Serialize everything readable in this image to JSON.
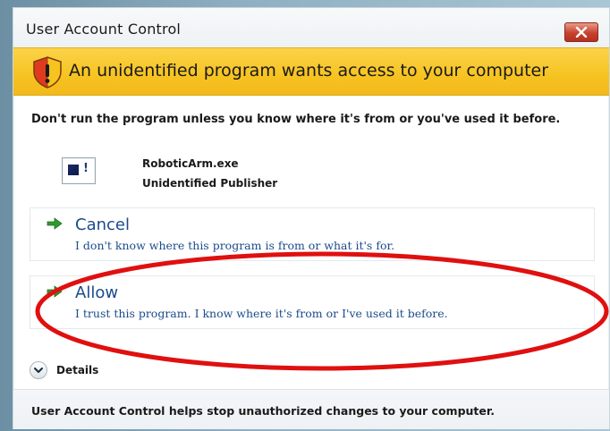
{
  "window": {
    "title": "User Account Control",
    "close_icon": "close-icon"
  },
  "banner": {
    "icon": "shield-warning-icon",
    "text": "An unidentified program wants access to your computer"
  },
  "warning_text": "Don't run the program unless you know where it's from or you've used it before.",
  "program": {
    "icon": "program-icon",
    "name": "RoboticArm.exe",
    "publisher": "Unidentified Publisher"
  },
  "options": {
    "cancel": {
      "title": "Cancel",
      "description": "I don't know where this program is from or what it's for."
    },
    "allow": {
      "title": "Allow",
      "description": "I trust this program. I know where it's from or I've used it before."
    }
  },
  "details": {
    "label": "Details",
    "icon": "chevron-down-icon"
  },
  "footer": {
    "text": "User Account Control helps stop unauthorized changes to your computer."
  },
  "colors": {
    "banner_bg": "#f6c321",
    "option_text": "#1b4b8a",
    "arrow_green": "#2e9b2e",
    "highlight_ellipse": "#e01010",
    "close_button": "#c8412e"
  }
}
